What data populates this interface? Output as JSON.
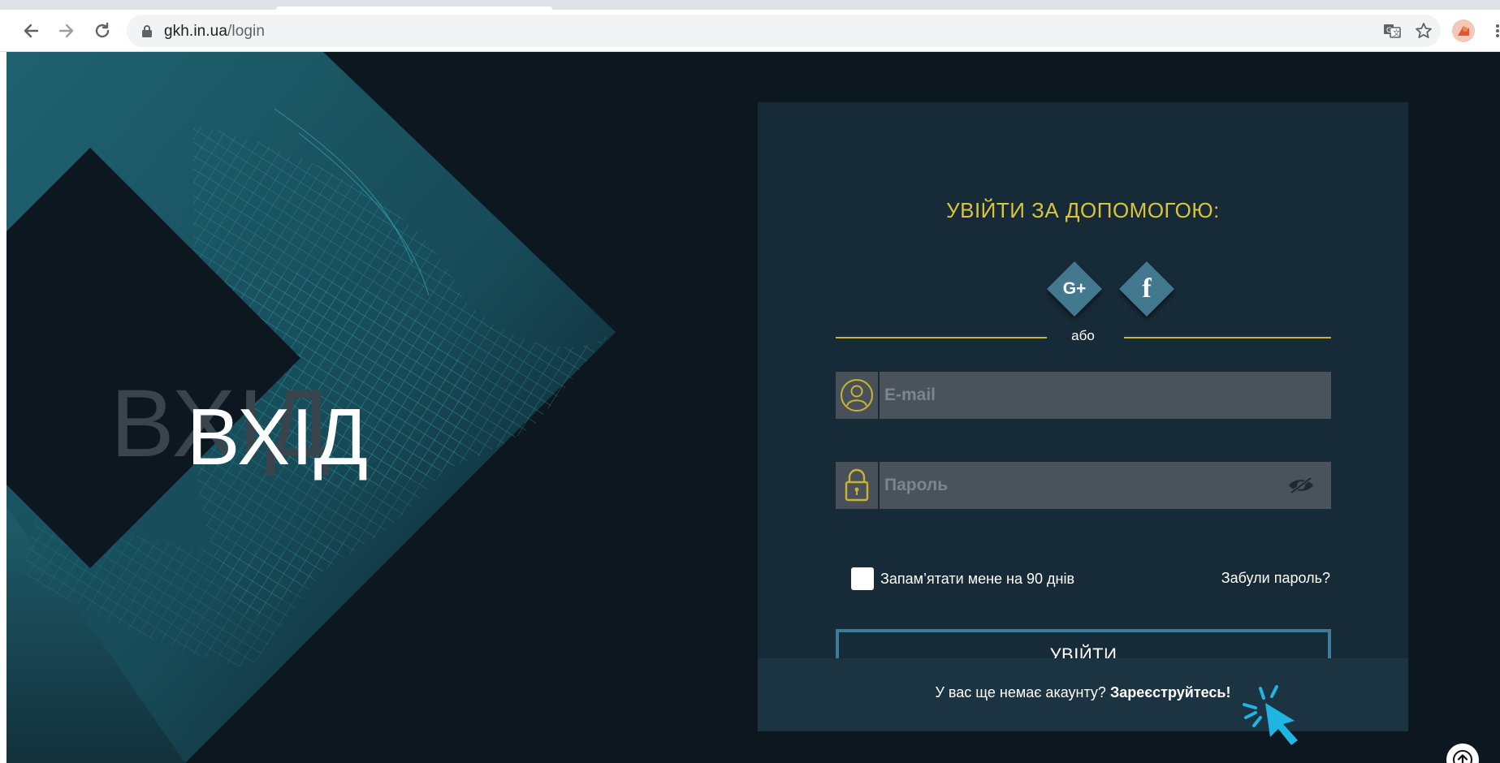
{
  "browser": {
    "url_host": "gkh.in.ua",
    "url_path": "/login",
    "icons": {
      "back": "back-arrow-icon",
      "forward": "forward-arrow-icon",
      "reload": "reload-icon",
      "lock": "lock-icon",
      "translate": "translate-icon",
      "bookmark": "star-icon",
      "profile": "profile-avatar"
    }
  },
  "hero": {
    "title": "ВХІД",
    "ghost_title": "ВХІД"
  },
  "login": {
    "heading": "УВІЙТИ ЗА ДОПОМОГОЮ:",
    "social": [
      {
        "label": "G+",
        "icon": "google-plus-icon"
      },
      {
        "label": "f",
        "icon": "facebook-icon"
      }
    ],
    "or_text": "або",
    "email_placeholder": "E-mail",
    "password_placeholder": "Пароль",
    "remember_label": "Запам’ятати мене на 90 днів",
    "forgot_label": "Забули пароль?",
    "submit_label": "УВІЙТИ",
    "signup_prompt": "У вас ще немає акаунту?",
    "signup_link": "Зареєструйтесь!"
  },
  "colors": {
    "page_bg": "#0c1720",
    "panel_bg": "#172a37",
    "accent_yellow": "#d9c43a",
    "accent_teal": "#3d7d99",
    "social_diamond": "#43798f"
  }
}
